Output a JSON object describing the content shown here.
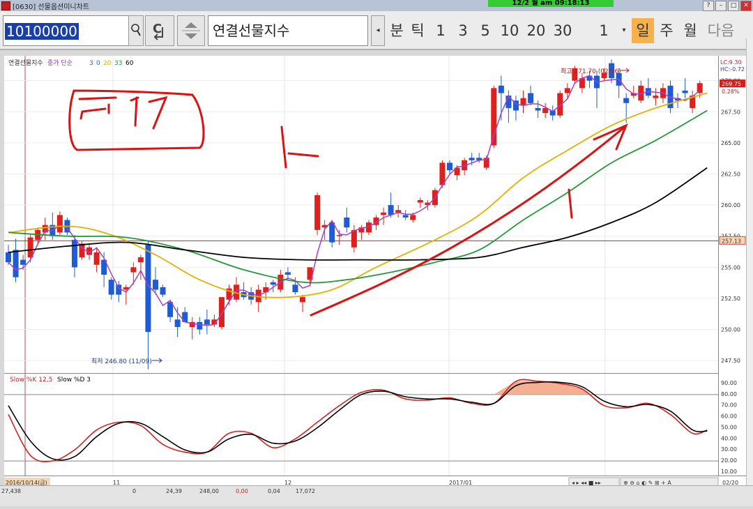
{
  "window": {
    "title": "[0630] 선물옵션미니차트",
    "clock": "12/2 월 am 09:18:13"
  },
  "toolbar": {
    "code_value": "10100000",
    "instrument_name": "연결선물지수",
    "unit_labels": [
      "분",
      "틱"
    ],
    "intervals": [
      "1",
      "3",
      "5",
      "10",
      "20",
      "30"
    ],
    "count_value": "1",
    "period_labels": [
      "일",
      "주",
      "월"
    ],
    "next_label": "다음",
    "active_period": "일"
  },
  "legend": {
    "name": "연결선물지수",
    "ma_label": "종가 단순",
    "ma_periods": [
      "3",
      "0",
      "20",
      "33",
      "60"
    ],
    "ma_colors": [
      "#9933cc",
      "#2266dd",
      "#e8b000",
      "#22993a",
      "#000000"
    ]
  },
  "annotations": {
    "high": "최고 271.70 (02/06)",
    "low": "최저 246.80 (11/09)",
    "lc": "LC:9.30",
    "hc": "HC:-0.72",
    "current_price": "269.75",
    "change_pct": "0.28%",
    "ref_price": "257.13"
  },
  "sub_legend": {
    "k_label": "Slow %K 12,5",
    "d_label": "Slow %D 3"
  },
  "price_axis": [
    "270.00",
    "267.50",
    "265.00",
    "262.50",
    "260.00",
    "257.50",
    "255.00",
    "252.50",
    "250.00",
    "247.50"
  ],
  "osc_axis": [
    "90.00",
    "80.00",
    "70.00",
    "60.00",
    "50.00",
    "40.00",
    "30.00",
    "20.00",
    "10.00"
  ],
  "date_axis": [
    "2016/10/14(금)",
    "11",
    "12",
    "2017/01",
    "02",
    "02/20"
  ],
  "bottom_values": [
    "27,438",
    "0",
    "24,39",
    "248,00",
    "0,00",
    "0,04",
    "17,072"
  ],
  "colors": {
    "up": "#e0201c",
    "down": "#1e5bd6",
    "ref_line": "#cc2222"
  },
  "chart_data": {
    "type": "candlestick",
    "ylim": [
      246.5,
      272
    ],
    "candles": [
      {
        "o": 256.2,
        "h": 256.8,
        "l": 255.2,
        "c": 255.4
      },
      {
        "o": 256.4,
        "h": 257.3,
        "l": 253.8,
        "c": 254.2
      },
      {
        "o": 255.6,
        "h": 256.0,
        "l": 254.8,
        "c": 255.2
      },
      {
        "o": 255.8,
        "h": 257.7,
        "l": 255.4,
        "c": 257.4
      },
      {
        "o": 257.2,
        "h": 258.2,
        "l": 256.8,
        "c": 258.0
      },
      {
        "o": 257.8,
        "h": 259.0,
        "l": 257.2,
        "c": 258.4
      },
      {
        "o": 258.4,
        "h": 259.4,
        "l": 257.2,
        "c": 257.5
      },
      {
        "o": 257.8,
        "h": 259.5,
        "l": 257.6,
        "c": 259.2
      },
      {
        "o": 258.8,
        "h": 259.0,
        "l": 257.6,
        "c": 257.8
      },
      {
        "o": 257.2,
        "h": 257.6,
        "l": 254.2,
        "c": 255.0
      },
      {
        "o": 255.8,
        "h": 257.1,
        "l": 255.6,
        "c": 256.9
      },
      {
        "o": 256.0,
        "h": 256.8,
        "l": 255.6,
        "c": 256.6
      },
      {
        "o": 255.2,
        "h": 256.5,
        "l": 254.6,
        "c": 256.2
      },
      {
        "o": 255.6,
        "h": 256.2,
        "l": 253.4,
        "c": 254.4
      },
      {
        "o": 254.0,
        "h": 254.2,
        "l": 252.4,
        "c": 252.8
      },
      {
        "o": 253.6,
        "h": 253.9,
        "l": 252.2,
        "c": 252.8
      },
      {
        "o": 253.2,
        "h": 253.6,
        "l": 252.0,
        "c": 253.4
      },
      {
        "o": 254.6,
        "h": 255.4,
        "l": 253.6,
        "c": 255.0
      },
      {
        "o": 255.4,
        "h": 256.0,
        "l": 254.0,
        "c": 255.8
      },
      {
        "o": 256.8,
        "h": 257.2,
        "l": 246.8,
        "c": 249.8
      },
      {
        "o": 254.0,
        "h": 255.0,
        "l": 252.8,
        "c": 253.2
      },
      {
        "o": 253.4,
        "h": 253.6,
        "l": 252.6,
        "c": 252.8
      },
      {
        "o": 252.2,
        "h": 252.4,
        "l": 250.6,
        "c": 251.0
      },
      {
        "o": 250.8,
        "h": 251.8,
        "l": 249.4,
        "c": 250.2
      },
      {
        "o": 251.4,
        "h": 251.8,
        "l": 250.6,
        "c": 250.6
      },
      {
        "o": 250.2,
        "h": 251.0,
        "l": 249.2,
        "c": 250.6
      },
      {
        "o": 250.6,
        "h": 251.0,
        "l": 249.6,
        "c": 250.0
      },
      {
        "o": 250.8,
        "h": 251.6,
        "l": 249.6,
        "c": 250.4
      },
      {
        "o": 250.4,
        "h": 251.2,
        "l": 250.2,
        "c": 250.8
      },
      {
        "o": 250.2,
        "h": 252.6,
        "l": 250.0,
        "c": 252.6
      },
      {
        "o": 252.4,
        "h": 253.6,
        "l": 252.0,
        "c": 253.3
      },
      {
        "o": 252.4,
        "h": 254.2,
        "l": 252.2,
        "c": 253.6
      },
      {
        "o": 253.0,
        "h": 253.8,
        "l": 252.4,
        "c": 252.6
      },
      {
        "o": 253.0,
        "h": 253.4,
        "l": 252.0,
        "c": 252.4
      },
      {
        "o": 252.2,
        "h": 253.6,
        "l": 251.4,
        "c": 253.2
      },
      {
        "o": 253.0,
        "h": 253.8,
        "l": 252.4,
        "c": 253.4
      },
      {
        "o": 253.8,
        "h": 254.0,
        "l": 253.0,
        "c": 253.6
      },
      {
        "o": 253.2,
        "h": 254.8,
        "l": 253.0,
        "c": 254.4
      },
      {
        "o": 254.6,
        "h": 255.0,
        "l": 254.0,
        "c": 254.4
      },
      {
        "o": 253.6,
        "h": 254.2,
        "l": 252.8,
        "c": 253.0
      },
      {
        "o": 252.2,
        "h": 252.8,
        "l": 251.4,
        "c": 252.6
      },
      {
        "o": 254.0,
        "h": 255.0,
        "l": 253.6,
        "c": 255.0
      },
      {
        "o": 258.0,
        "h": 261.0,
        "l": 257.6,
        "c": 260.8
      },
      {
        "o": 258.2,
        "h": 258.8,
        "l": 257.2,
        "c": 258.4
      },
      {
        "o": 258.6,
        "h": 258.8,
        "l": 256.6,
        "c": 257.0
      },
      {
        "o": 257.6,
        "h": 258.0,
        "l": 256.8,
        "c": 257.6
      },
      {
        "o": 259.0,
        "h": 259.8,
        "l": 257.8,
        "c": 258.2
      },
      {
        "o": 256.6,
        "h": 258.4,
        "l": 256.2,
        "c": 258.0
      },
      {
        "o": 257.8,
        "h": 258.4,
        "l": 257.2,
        "c": 258.2
      },
      {
        "o": 257.8,
        "h": 258.8,
        "l": 257.6,
        "c": 258.6
      },
      {
        "o": 258.4,
        "h": 259.2,
        "l": 258.0,
        "c": 259.0
      },
      {
        "o": 259.2,
        "h": 259.8,
        "l": 258.4,
        "c": 259.4
      },
      {
        "o": 260.0,
        "h": 261.0,
        "l": 259.0,
        "c": 259.2
      },
      {
        "o": 259.4,
        "h": 260.0,
        "l": 259.0,
        "c": 259.6
      },
      {
        "o": 259.2,
        "h": 259.6,
        "l": 258.8,
        "c": 259.0
      },
      {
        "o": 258.8,
        "h": 259.4,
        "l": 258.6,
        "c": 259.2
      },
      {
        "o": 260.2,
        "h": 260.6,
        "l": 259.8,
        "c": 260.4
      },
      {
        "o": 260.0,
        "h": 260.4,
        "l": 259.6,
        "c": 260.2
      },
      {
        "o": 260.0,
        "h": 261.4,
        "l": 259.8,
        "c": 261.2
      },
      {
        "o": 261.6,
        "h": 263.6,
        "l": 261.4,
        "c": 263.4
      },
      {
        "o": 263.4,
        "h": 263.6,
        "l": 262.4,
        "c": 262.8
      },
      {
        "o": 262.4,
        "h": 263.2,
        "l": 262.0,
        "c": 263.0
      },
      {
        "o": 262.8,
        "h": 263.8,
        "l": 262.4,
        "c": 263.6
      },
      {
        "o": 263.8,
        "h": 264.2,
        "l": 263.2,
        "c": 263.6
      },
      {
        "o": 263.8,
        "h": 264.2,
        "l": 263.4,
        "c": 263.6
      },
      {
        "o": 263.0,
        "h": 264.0,
        "l": 262.8,
        "c": 263.8
      },
      {
        "o": 264.8,
        "h": 269.6,
        "l": 264.6,
        "c": 269.4
      },
      {
        "o": 269.6,
        "h": 270.4,
        "l": 266.8,
        "c": 269.0
      },
      {
        "o": 268.8,
        "h": 269.2,
        "l": 266.6,
        "c": 267.8
      },
      {
        "o": 268.4,
        "h": 268.8,
        "l": 266.8,
        "c": 267.6
      },
      {
        "o": 268.0,
        "h": 269.2,
        "l": 267.4,
        "c": 268.6
      },
      {
        "o": 269.0,
        "h": 269.6,
        "l": 268.0,
        "c": 268.2
      },
      {
        "o": 267.8,
        "h": 268.4,
        "l": 267.0,
        "c": 267.6
      },
      {
        "o": 267.4,
        "h": 268.2,
        "l": 267.0,
        "c": 267.8
      },
      {
        "o": 267.6,
        "h": 268.0,
        "l": 266.8,
        "c": 267.2
      },
      {
        "o": 267.2,
        "h": 269.2,
        "l": 267.0,
        "c": 269.0
      },
      {
        "o": 269.0,
        "h": 269.8,
        "l": 268.6,
        "c": 269.4
      },
      {
        "o": 270.0,
        "h": 271.2,
        "l": 269.8,
        "c": 271.0
      },
      {
        "o": 269.4,
        "h": 270.6,
        "l": 269.0,
        "c": 270.2
      },
      {
        "o": 270.4,
        "h": 270.8,
        "l": 269.4,
        "c": 270.0
      },
      {
        "o": 270.4,
        "h": 270.8,
        "l": 267.8,
        "c": 269.4
      },
      {
        "o": 270.2,
        "h": 271.0,
        "l": 270.0,
        "c": 270.6
      },
      {
        "o": 271.4,
        "h": 271.7,
        "l": 269.8,
        "c": 270.2
      },
      {
        "o": 270.6,
        "h": 271.0,
        "l": 268.6,
        "c": 269.6
      },
      {
        "o": 268.6,
        "h": 269.0,
        "l": 266.6,
        "c": 268.2
      },
      {
        "o": 268.8,
        "h": 269.6,
        "l": 268.6,
        "c": 269.0
      },
      {
        "o": 268.4,
        "h": 270.0,
        "l": 268.2,
        "c": 269.6
      },
      {
        "o": 269.4,
        "h": 270.2,
        "l": 268.6,
        "c": 268.8
      },
      {
        "o": 268.6,
        "h": 269.4,
        "l": 268.0,
        "c": 268.8
      },
      {
        "o": 268.6,
        "h": 269.8,
        "l": 268.2,
        "c": 269.4
      },
      {
        "o": 269.6,
        "h": 270.0,
        "l": 267.4,
        "c": 267.8
      },
      {
        "o": 268.6,
        "h": 269.0,
        "l": 267.8,
        "c": 268.4
      },
      {
        "o": 269.2,
        "h": 270.2,
        "l": 268.6,
        "c": 269.0
      },
      {
        "o": 267.8,
        "h": 269.2,
        "l": 267.4,
        "c": 268.8
      },
      {
        "o": 269.0,
        "h": 270.0,
        "l": 268.6,
        "c": 269.8
      }
    ],
    "ma_control": [
      [
        0,
        256.6
      ],
      [
        8,
        257.8
      ],
      [
        16,
        256.8
      ],
      [
        22,
        255.6
      ],
      [
        28,
        253.4
      ],
      [
        32,
        252.6
      ],
      [
        38,
        252.8
      ],
      [
        44,
        253.6
      ],
      [
        50,
        256.2
      ],
      [
        56,
        258.8
      ],
      [
        62,
        261.2
      ],
      [
        68,
        264.6
      ],
      [
        74,
        267.2
      ],
      [
        80,
        268.4
      ],
      [
        86,
        268.9
      ],
      [
        95,
        269.3
      ]
    ],
    "ma20_control": [
      [
        0,
        257.8
      ],
      [
        8,
        258.3
      ],
      [
        14,
        257.6
      ],
      [
        20,
        256.0
      ],
      [
        26,
        254.0
      ],
      [
        32,
        252.8
      ],
      [
        38,
        252.6
      ],
      [
        44,
        253.2
      ],
      [
        50,
        255.0
      ],
      [
        58,
        257.2
      ],
      [
        64,
        259.2
      ],
      [
        70,
        262.2
      ],
      [
        76,
        264.4
      ],
      [
        82,
        266.4
      ],
      [
        88,
        267.8
      ],
      [
        95,
        269.0
      ]
    ],
    "ma33_control": [
      [
        0,
        257.8
      ],
      [
        8,
        257.5
      ],
      [
        16,
        257.4
      ],
      [
        24,
        256.4
      ],
      [
        32,
        254.8
      ],
      [
        40,
        253.8
      ],
      [
        46,
        254.0
      ],
      [
        52,
        254.6
      ],
      [
        58,
        255.4
      ],
      [
        64,
        256.4
      ],
      [
        70,
        258.8
      ],
      [
        76,
        261.0
      ],
      [
        82,
        263.4
      ],
      [
        88,
        265.2
      ],
      [
        95,
        267.6
      ]
    ],
    "ma60_control": [
      [
        0,
        256.2
      ],
      [
        8,
        256.7
      ],
      [
        16,
        257.0
      ],
      [
        24,
        256.4
      ],
      [
        32,
        255.8
      ],
      [
        40,
        255.6
      ],
      [
        48,
        255.6
      ],
      [
        56,
        255.6
      ],
      [
        64,
        255.8
      ],
      [
        70,
        256.6
      ],
      [
        76,
        257.4
      ],
      [
        82,
        258.6
      ],
      [
        88,
        260.2
      ],
      [
        95,
        263.0
      ]
    ],
    "stoch_k": [
      [
        0,
        62
      ],
      [
        3,
        25
      ],
      [
        6,
        20
      ],
      [
        9,
        30
      ],
      [
        12,
        48
      ],
      [
        15,
        55
      ],
      [
        18,
        52
      ],
      [
        21,
        35
      ],
      [
        24,
        28
      ],
      [
        27,
        28
      ],
      [
        30,
        45
      ],
      [
        33,
        45
      ],
      [
        36,
        32
      ],
      [
        39,
        40
      ],
      [
        42,
        55
      ],
      [
        45,
        70
      ],
      [
        48,
        82
      ],
      [
        51,
        84
      ],
      [
        54,
        76
      ],
      [
        57,
        75
      ],
      [
        60,
        77
      ],
      [
        63,
        72
      ],
      [
        66,
        72
      ],
      [
        69,
        92
      ],
      [
        72,
        92
      ],
      [
        75,
        90
      ],
      [
        78,
        85
      ],
      [
        81,
        70
      ],
      [
        84,
        68
      ],
      [
        87,
        72
      ],
      [
        90,
        62
      ],
      [
        93,
        45
      ],
      [
        95,
        48
      ]
    ],
    "stoch_d": [
      [
        0,
        70
      ],
      [
        3,
        38
      ],
      [
        6,
        22
      ],
      [
        9,
        24
      ],
      [
        12,
        42
      ],
      [
        15,
        54
      ],
      [
        18,
        54
      ],
      [
        21,
        42
      ],
      [
        24,
        30
      ],
      [
        27,
        28
      ],
      [
        30,
        40
      ],
      [
        33,
        44
      ],
      [
        36,
        36
      ],
      [
        39,
        38
      ],
      [
        42,
        50
      ],
      [
        45,
        66
      ],
      [
        48,
        80
      ],
      [
        51,
        83
      ],
      [
        54,
        78
      ],
      [
        57,
        76
      ],
      [
        60,
        76
      ],
      [
        63,
        73
      ],
      [
        66,
        72
      ],
      [
        69,
        88
      ],
      [
        72,
        91
      ],
      [
        75,
        91
      ],
      [
        78,
        87
      ],
      [
        81,
        74
      ],
      [
        84,
        69
      ],
      [
        87,
        71
      ],
      [
        90,
        65
      ],
      [
        93,
        48
      ],
      [
        95,
        47
      ]
    ],
    "osc_lines": [
      80,
      20
    ]
  }
}
